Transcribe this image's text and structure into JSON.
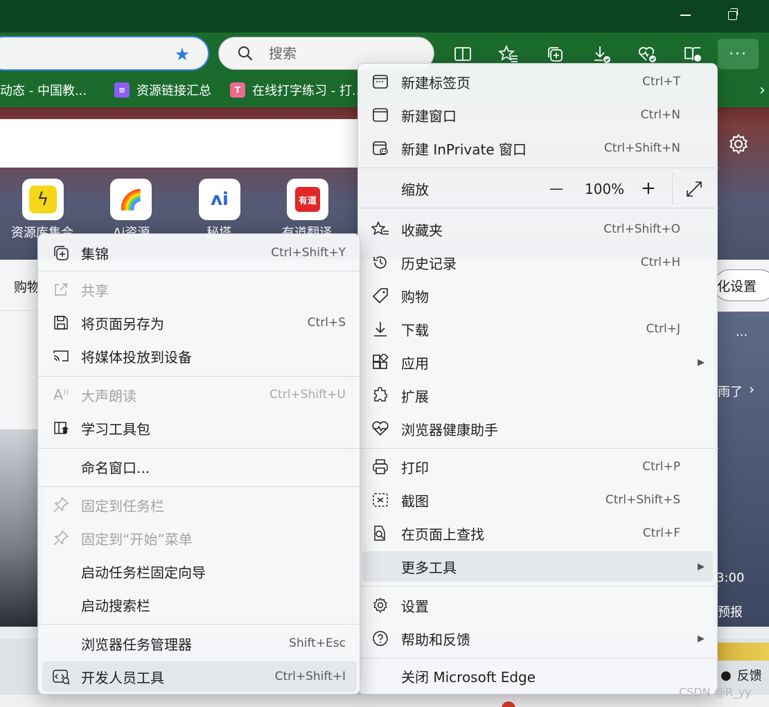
{
  "window": {
    "minimize_icon": "minimize-icon",
    "restore_icon": "restore-icon"
  },
  "toolbar": {
    "search_placeholder": "搜索",
    "favorite_star_icon": "star-filled-icon",
    "icons": [
      "split-screen-icon",
      "favorites-icon",
      "collections-icon",
      "downloads-icon",
      "browser-essentials-icon",
      "reading-view-icon"
    ],
    "more_label": "···",
    "accent_color": "#1b6b2d"
  },
  "bookmarks": [
    {
      "label": "动态 - 中国教..."
    },
    {
      "label": "资源链接汇总",
      "color": "#8b5cf6"
    },
    {
      "label": "在线打字练习 - 打...",
      "color": "#ec6b8f"
    }
  ],
  "page": {
    "apps": [
      {
        "label": "资源库集合",
        "glyph": "ϟ",
        "color": "#f5d619"
      },
      {
        "label": "Ai资源",
        "glyph": "🌈"
      },
      {
        "label": "秘塔",
        "glyph": "ʌi",
        "color": "#2b66d9"
      },
      {
        "label": "有道翻译",
        "glyph": "有道",
        "color": "#e32726"
      }
    ],
    "left_tab": "购物",
    "personalize": "化设置",
    "weather_text": "雨了",
    "weather_time": "3:00",
    "weather_forecast": "预报",
    "feedback": "反馈",
    "watermark": "CSDN @R_yy"
  },
  "main_menu": {
    "items": [
      {
        "label": "新建标签页",
        "shortcut": "Ctrl+T",
        "icon": "new-tab-icon"
      },
      {
        "label": "新建窗口",
        "shortcut": "Ctrl+N",
        "icon": "new-window-icon"
      },
      {
        "label": "新建 InPrivate 窗口",
        "shortcut": "Ctrl+Shift+N",
        "icon": "inprivate-icon"
      },
      {
        "label": "缩放",
        "zoom_value": "100%",
        "minus": "—",
        "plus": "+"
      },
      {
        "label": "收藏夹",
        "shortcut": "Ctrl+Shift+O",
        "icon": "favorites-icon"
      },
      {
        "label": "历史记录",
        "shortcut": "Ctrl+H",
        "icon": "history-icon"
      },
      {
        "label": "购物",
        "shortcut": "",
        "icon": "shopping-tag-icon"
      },
      {
        "label": "下载",
        "shortcut": "Ctrl+J",
        "icon": "download-icon"
      },
      {
        "label": "应用",
        "shortcut": "",
        "icon": "apps-icon"
      },
      {
        "label": "扩展",
        "shortcut": "",
        "icon": "extensions-icon"
      },
      {
        "label": "浏览器健康助手",
        "shortcut": "",
        "icon": "health-icon"
      },
      {
        "label": "打印",
        "shortcut": "Ctrl+P",
        "icon": "print-icon"
      },
      {
        "label": "截图",
        "shortcut": "Ctrl+Shift+S",
        "icon": "screenshot-icon"
      },
      {
        "label": "在页面上查找",
        "shortcut": "Ctrl+F",
        "icon": "find-on-page-icon"
      },
      {
        "label": "更多工具",
        "shortcut": ""
      },
      {
        "label": "设置",
        "shortcut": "",
        "icon": "settings-icon"
      },
      {
        "label": "帮助和反馈",
        "shortcut": "",
        "icon": "help-icon"
      },
      {
        "label": "关闭 Microsoft Edge",
        "shortcut": ""
      }
    ]
  },
  "sub_menu": {
    "items": [
      {
        "label": "集锦",
        "shortcut": "Ctrl+Shift+Y",
        "icon": "collections-icon"
      },
      {
        "label": "共享",
        "shortcut": "",
        "icon": "share-icon",
        "disabled": true
      },
      {
        "label": "将页面另存为",
        "shortcut": "Ctrl+S",
        "icon": "save-page-icon"
      },
      {
        "label": "将媒体投放到设备",
        "shortcut": "",
        "icon": "cast-icon"
      },
      {
        "label": "大声朗读",
        "shortcut": "Ctrl+Shift+U",
        "icon": "read-aloud-icon",
        "disabled": true
      },
      {
        "label": "学习工具包",
        "shortcut": "",
        "icon": "learning-toolkit-icon"
      },
      {
        "label": "命名窗口...",
        "shortcut": ""
      },
      {
        "label": "固定到任务栏",
        "shortcut": "",
        "icon": "pin-icon",
        "disabled": true
      },
      {
        "label": "固定到“开始”菜单",
        "shortcut": "",
        "icon": "pin-icon",
        "disabled": true
      },
      {
        "label": "启动任务栏固定向导",
        "shortcut": ""
      },
      {
        "label": "启动搜索栏",
        "shortcut": ""
      },
      {
        "label": "浏览器任务管理器",
        "shortcut": "Shift+Esc"
      },
      {
        "label": "开发人员工具",
        "shortcut": "Ctrl+Shift+I",
        "icon": "developer-tools-icon"
      }
    ]
  }
}
